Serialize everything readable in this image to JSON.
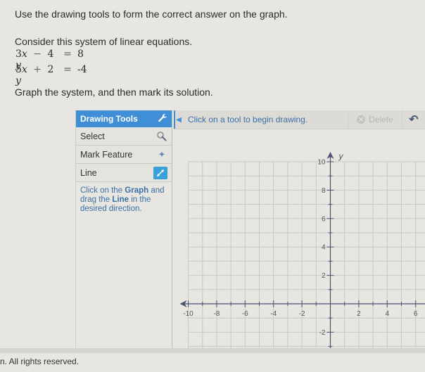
{
  "question": {
    "instruction": "Use the drawing tools to form the correct answer on the graph.",
    "consider": "Consider this system of linear equations.",
    "equations": [
      {
        "a": "3",
        "op1": "−",
        "b": "4",
        "eq": "=",
        "rhs": "8"
      },
      {
        "a": "5",
        "op1": "+",
        "b": "2",
        "eq": "=",
        "rhs": "-4"
      }
    ],
    "task": "Graph the system, and then mark its solution."
  },
  "tools_panel": {
    "title": "Drawing Tools",
    "title_icon": "wrench-icon",
    "tools": [
      {
        "label": "Select",
        "icon": "select-pointer-icon",
        "active": false
      },
      {
        "label": "Mark Feature",
        "icon": "sparkle-icon",
        "active": false
      },
      {
        "label": "Line",
        "icon": "line-arrows-icon",
        "active": true
      }
    ],
    "hint": {
      "p1": "Click on the ",
      "b1": "Graph",
      "p2": " and drag the ",
      "b2": "Line",
      "p3": " in the desired direction."
    }
  },
  "toolbar": {
    "collapse_icon": "collapse-left-icon",
    "status": "Click on a tool to begin drawing.",
    "delete_label": "Delete",
    "delete_icon": "close-circle-icon",
    "undo_icon": "undo-icon"
  },
  "graph": {
    "x_axis_label": "",
    "y_axis_label": "y",
    "x_ticks": [
      "-10",
      "-8",
      "-6",
      "-4",
      "-2",
      "2",
      "4",
      "6"
    ],
    "y_ticks": [
      "10",
      "8",
      "6",
      "4",
      "2",
      "-2"
    ]
  },
  "footer": {
    "text": "n. All rights reserved."
  },
  "colors": {
    "accent": "#3f8ed6",
    "hint_text": "#3b6fa8",
    "axis": "#4a5470",
    "grid": "#c9c8c2"
  }
}
